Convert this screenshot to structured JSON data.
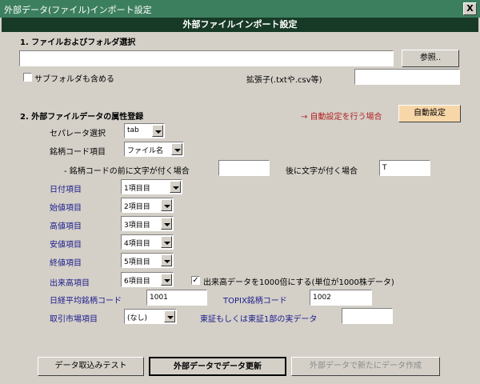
{
  "window": {
    "title": "外部データ(ファイル)インポート設定",
    "close_label": "X"
  },
  "header": {
    "title": "外部ファイルインポート設定"
  },
  "section1": {
    "heading": "1.  ファイルおよびフォルダ選択",
    "path_value": "",
    "browse_label": "参照..",
    "subfolder_label": "サブフォルダも含める",
    "subfolder_checked": false,
    "ext_label": "拡張子(.txtや.csv等)",
    "ext_value": ""
  },
  "section2": {
    "heading": "2.  外部ファイルデータの属性登録",
    "auto_hint": "→  自動設定を行う場合",
    "auto_button": "自動設定",
    "separator_label": "セパレータ選択",
    "separator_value": "tab",
    "code_label": "銘柄コード項目",
    "code_value": "ファイル名",
    "prefix_label": "- 銘柄コードの前に文字が付く場合",
    "prefix_value": "",
    "suffix_label": "後に文字が付く場合",
    "suffix_value": "T",
    "date_label": "日付項目",
    "date_value": "1項目目",
    "open_label": "始値項目",
    "open_value": "2項目目",
    "high_label": "高値項目",
    "high_value": "3項目目",
    "low_label": "安値項目",
    "low_value": "4項目目",
    "close_label": "終値項目",
    "close_value": "5項目目",
    "volume_label": "出来高項目",
    "volume_value": "6項目目",
    "volume_check_label": "出来高データを1000倍にする(単位が1000株データ)",
    "volume_checked": true,
    "nikkei_label": "日経平均銘柄コード",
    "nikkei_value": "1001",
    "topix_label": "TOPIX銘柄コード",
    "topix_value": "1002",
    "market_label": "取引市場項目",
    "market_value": "(なし)",
    "tse_label": "東証もしくは東証1部の実データ",
    "tse_value": ""
  },
  "footer": {
    "test_button": "データ取込みテスト",
    "update_button": "外部データでデータ更新",
    "create_button": "外部データで新たにデータ作成"
  },
  "colors": {
    "titlebar": "#3c7f5e",
    "header": "#173a26",
    "auto_button": "#f7d7a8",
    "label_blue": "#1a1a8c",
    "arrow_red": "#b22222"
  }
}
